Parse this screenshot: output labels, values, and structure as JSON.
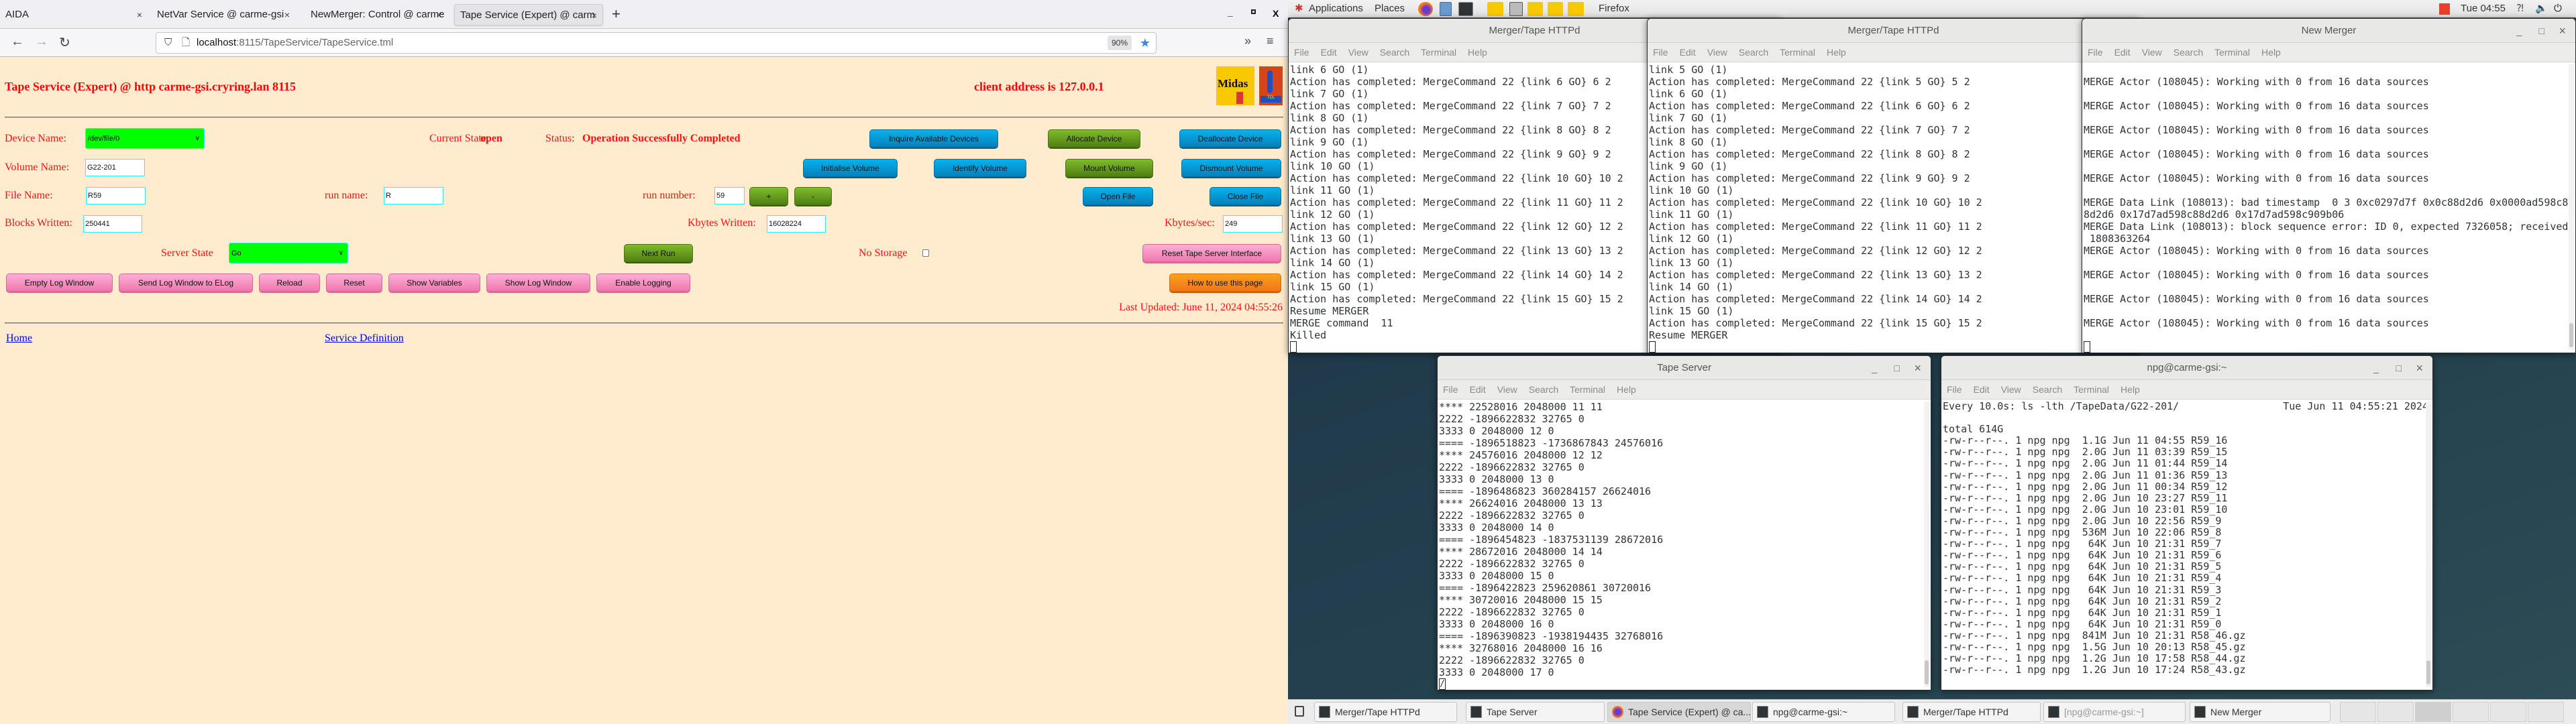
{
  "browser": {
    "tabs": [
      {
        "label": "AIDA"
      },
      {
        "label": "NetVar Service @ carme-gsi"
      },
      {
        "label": "NewMerger: Control @ carme"
      },
      {
        "label": "Tape Service (Expert) @ carm",
        "active": true
      }
    ],
    "new_tab": "+",
    "url_host": "localhost",
    "url_rest": ":8115/TapeService/TapeService.tml",
    "zoom": "90%"
  },
  "page": {
    "title": "Tape Service (Expert) @ http carme-gsi.cryring.lan 8115",
    "client_address": "client address is 127.0.0.1",
    "logos": {
      "midas": "Midas",
      "tcl": "TCL POWERED"
    },
    "device_name_label": "Device Name:",
    "device_name_value": "/dev/file/0",
    "current_state_label": "Current State:",
    "current_state_value": "open",
    "status_label": "Status:",
    "status_value": "Operation Successfully Completed",
    "volume_name_label": "Volume Name:",
    "volume_name_value": "G22-201",
    "file_name_label": "File Name:",
    "file_name_value": "R59",
    "run_name_label": "run name:",
    "run_name_value": "R",
    "run_number_label": "run number:",
    "run_number_value": "59",
    "blocks_written_label": "Blocks Written:",
    "blocks_written_value": "250441",
    "kbytes_written_label": "Kbytes Written:",
    "kbytes_written_value": "16028224",
    "kbytes_sec_label": "Kbytes/sec:",
    "kbytes_sec_value": "249",
    "server_state_label": "Server State",
    "server_state_value": "Go",
    "no_storage_label": "No Storage",
    "no_storage_checked": false,
    "buttons": {
      "inquire": "Inquire Available Devices",
      "allocate": "Allocate Device",
      "deallocate": "Deallocate Device",
      "initialise": "Initialise Volume",
      "identify": "Identify Volume",
      "mount": "Mount Volume",
      "dismount": "Dismount Volume",
      "plus": "+",
      "minus": "-",
      "open_file": "Open File",
      "close_file": "Close File",
      "next_run": "Next Run",
      "reset_interface": "Reset Tape Server Interface",
      "empty_log": "Empty Log Window",
      "send_log": "Send Log Window to ELog",
      "reload": "Reload",
      "reset": "Reset",
      "show_variables": "Show Variables",
      "show_log": "Show Log Window",
      "enable_logging": "Enable Logging",
      "how_to": "How to use this page"
    },
    "last_updated": "Last Updated: June 11, 2024 04:55:26",
    "links": {
      "home": "Home",
      "service_definition": "Service Definition"
    }
  },
  "desktop": {
    "panel": {
      "applications": "Applications",
      "places": "Places",
      "active_app": "Firefox",
      "clock": "Tue 04:55"
    },
    "terminal_menu": [
      "File",
      "Edit",
      "View",
      "Search",
      "Terminal",
      "Help"
    ],
    "windows": [
      {
        "title": "Merger/Tape HTTPd",
        "lines": [
          "link 6 GO (1)",
          "Action has completed: MergeCommand 22 {link 6 GO} 6 2",
          "link 7 GO (1)",
          "Action has completed: MergeCommand 22 {link 7 GO} 7 2",
          "link 8 GO (1)",
          "Action has completed: MergeCommand 22 {link 8 GO} 8 2",
          "link 9 GO (1)",
          "Action has completed: MergeCommand 22 {link 9 GO} 9 2",
          "link 10 GO (1)",
          "Action has completed: MergeCommand 22 {link 10 GO} 10 2",
          "link 11 GO (1)",
          "Action has completed: MergeCommand 22 {link 11 GO} 11 2",
          "link 12 GO (1)",
          "Action has completed: MergeCommand 22 {link 12 GO} 12 2",
          "link 13 GO (1)",
          "Action has completed: MergeCommand 22 {link 13 GO} 13 2",
          "link 14 GO (1)",
          "Action has completed: MergeCommand 22 {link 14 GO} 14 2",
          "link 15 GO (1)",
          "Action has completed: MergeCommand 22 {link 15 GO} 15 2",
          "Resume MERGER",
          "MERGE command  11",
          "Killed"
        ],
        "cursor": ""
      },
      {
        "title": "Merger/Tape HTTPd",
        "lines": [
          "link 5 GO (1)",
          "Action has completed: MergeCommand 22 {link 5 GO} 5 2",
          "link 6 GO (1)",
          "Action has completed: MergeCommand 22 {link 6 GO} 6 2",
          "link 7 GO (1)",
          "Action has completed: MergeCommand 22 {link 7 GO} 7 2",
          "link 8 GO (1)",
          "Action has completed: MergeCommand 22 {link 8 GO} 8 2",
          "link 9 GO (1)",
          "Action has completed: MergeCommand 22 {link 9 GO} 9 2",
          "link 10 GO (1)",
          "Action has completed: MergeCommand 22 {link 10 GO} 10 2",
          "link 11 GO (1)",
          "Action has completed: MergeCommand 22 {link 11 GO} 11 2",
          "link 12 GO (1)",
          "Action has completed: MergeCommand 22 {link 12 GO} 12 2",
          "link 13 GO (1)",
          "Action has completed: MergeCommand 22 {link 13 GO} 13 2",
          "link 14 GO (1)",
          "Action has completed: MergeCommand 22 {link 14 GO} 14 2",
          "link 15 GO (1)",
          "Action has completed: MergeCommand 22 {link 15 GO} 15 2",
          "Resume MERGER"
        ],
        "cursor": ""
      },
      {
        "title": "New Merger",
        "lines": [
          "",
          "MERGE Actor (108045): Working with 0 from 16 data sources",
          "",
          "MERGE Actor (108045): Working with 0 from 16 data sources",
          "",
          "MERGE Actor (108045): Working with 0 from 16 data sources",
          "",
          "MERGE Actor (108045): Working with 0 from 16 data sources",
          "",
          "MERGE Actor (108045): Working with 0 from 16 data sources",
          "",
          "MERGE Data Link (108013): bad timestamp  0 3 0xc0297d7f 0x0c88d2d6 0x0000ad598c8",
          "8d2d6 0x17d7ad598c88d2d6 0x17d7ad598c909b06",
          "MERGE Data Link (108013): block sequence error: ID 0, expected 7326058; received",
          " 1808363264",
          "MERGE Actor (108045): Working with 0 from 16 data sources",
          "",
          "MERGE Actor (108045): Working with 0 from 16 data sources",
          "",
          "MERGE Actor (108045): Working with 0 from 16 data sources",
          "",
          "MERGE Actor (108045): Working with 0 from 16 data sources",
          ""
        ],
        "cursor": ""
      },
      {
        "title": "Tape Server",
        "lines": [
          "**** 22528016 2048000 11 11",
          "2222 -1896622832 32765 0",
          "3333 0 2048000 12 0",
          "==== -1896518823 -1736867843 24576016",
          "**** 24576016 2048000 12 12",
          "2222 -1896622832 32765 0",
          "3333 0 2048000 13 0",
          "==== -1896486823 360284157 26624016",
          "**** 26624016 2048000 13 13",
          "2222 -1896622832 32765 0",
          "3333 0 2048000 14 0",
          "==== -1896454823 -1837531139 28672016",
          "**** 28672016 2048000 14 14",
          "2222 -1896622832 32765 0",
          "3333 0 2048000 15 0",
          "==== -1896422823 259620861 30720016",
          "**** 30720016 2048000 15 15",
          "2222 -1896622832 32765 0",
          "3333 0 2048000 16 0",
          "==== -1896390823 -1938194435 32768016",
          "**** 32768016 2048000 16 16",
          "2222 -1896622832 32765 0",
          "3333 0 2048000 17 0"
        ],
        "cursor": "/"
      },
      {
        "title": "npg@carme-gsi:~",
        "header_left": "Every 10.0s: ls -lth /TapeData/G22-201/",
        "header_right": "Tue Jun 11 04:55:21 2024",
        "lines": [
          "",
          "total 614G",
          "-rw-r--r--. 1 npg npg  1.1G Jun 11 04:55 R59_16",
          "-rw-r--r--. 1 npg npg  2.0G Jun 11 03:39 R59_15",
          "-rw-r--r--. 1 npg npg  2.0G Jun 11 01:44 R59_14",
          "-rw-r--r--. 1 npg npg  2.0G Jun 11 01:36 R59_13",
          "-rw-r--r--. 1 npg npg  2.0G Jun 11 00:34 R59_12",
          "-rw-r--r--. 1 npg npg  2.0G Jun 10 23:27 R59_11",
          "-rw-r--r--. 1 npg npg  2.0G Jun 10 23:01 R59_10",
          "-rw-r--r--. 1 npg npg  2.0G Jun 10 22:56 R59_9",
          "-rw-r--r--. 1 npg npg  536M Jun 10 22:06 R59_8",
          "-rw-r--r--. 1 npg npg   64K Jun 10 21:31 R59_7",
          "-rw-r--r--. 1 npg npg   64K Jun 10 21:31 R59_6",
          "-rw-r--r--. 1 npg npg   64K Jun 10 21:31 R59_5",
          "-rw-r--r--. 1 npg npg   64K Jun 10 21:31 R59_4",
          "-rw-r--r--. 1 npg npg   64K Jun 10 21:31 R59_3",
          "-rw-r--r--. 1 npg npg   64K Jun 10 21:31 R59_2",
          "-rw-r--r--. 1 npg npg   64K Jun 10 21:31 R59_1",
          "-rw-r--r--. 1 npg npg   64K Jun 10 21:31 R59_0",
          "-rw-r--r--. 1 npg npg  841M Jun 10 21:31 R58_46.gz",
          "-rw-r--r--. 1 npg npg  1.5G Jun 10 20:13 R58_45.gz",
          "-rw-r--r--. 1 npg npg  1.2G Jun 10 17:58 R58_44.gz",
          "-rw-r--r--. 1 npg npg  1.2G Jun 10 17:24 R58_43.gz"
        ]
      }
    ],
    "taskbar": [
      {
        "label": "Merger/Tape HTTPd"
      },
      {
        "label": "Tape Server"
      },
      {
        "label": "Tape Service (Expert) @ ca...",
        "active": true
      },
      {
        "label": "npg@carme-gsi:~"
      },
      {
        "label": "Merger/Tape HTTPd"
      },
      {
        "label": "[npg@carme-gsi:~]",
        "dim": true
      },
      {
        "label": "New Merger"
      }
    ],
    "workspaces": 6,
    "active_workspace": 3
  }
}
